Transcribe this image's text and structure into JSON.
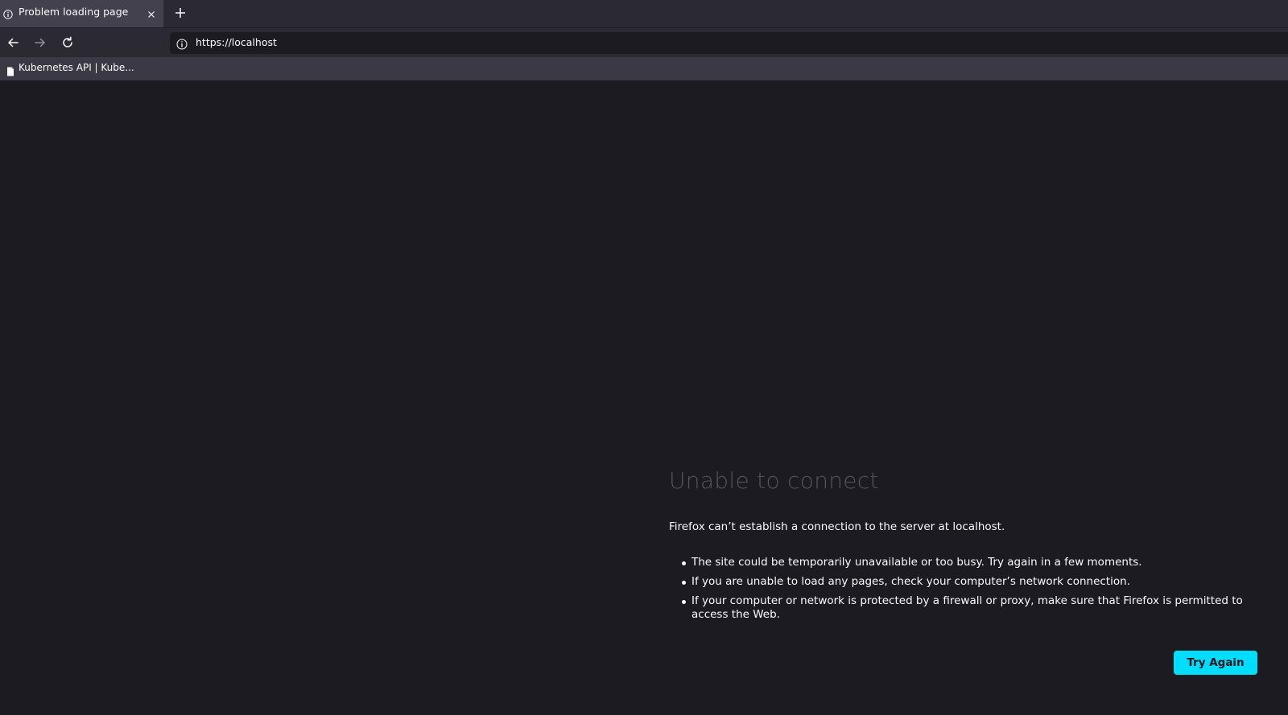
{
  "browser": {
    "tab": {
      "title": "Problem loading page",
      "icon": "info-icon",
      "close_icon": "close-icon"
    },
    "new_tab_icon": "plus-icon",
    "nav": {
      "back_icon": "arrow-left-icon",
      "forward_icon": "arrow-right-icon",
      "reload_icon": "reload-icon"
    },
    "url": {
      "value": "https://localhost",
      "icon": "info-icon"
    },
    "bookmarks": [
      {
        "label": "Kubernetes API | Kube...",
        "icon": "page-icon"
      }
    ]
  },
  "error_page": {
    "title": "Unable to connect",
    "description": "Firefox can’t establish a connection to the server at localhost.",
    "bullets": [
      "The site could be temporarily unavailable or too busy. Try again in a few moments.",
      "If you are unable to load any pages, check your computer’s network connection.",
      "If your computer or network is protected by a firewall or proxy, make sure that Firefox is permitted to access the Web."
    ],
    "button_label": "Try Again"
  },
  "colors": {
    "page_bg": "#1c1b22",
    "tabbar_bg": "#2b2a33",
    "active_tab_bg": "#42414d",
    "bookmarks_bg": "#3a3944",
    "accent": "#00ddff",
    "title_text": "#54535c",
    "text": "#fbfbfe"
  }
}
